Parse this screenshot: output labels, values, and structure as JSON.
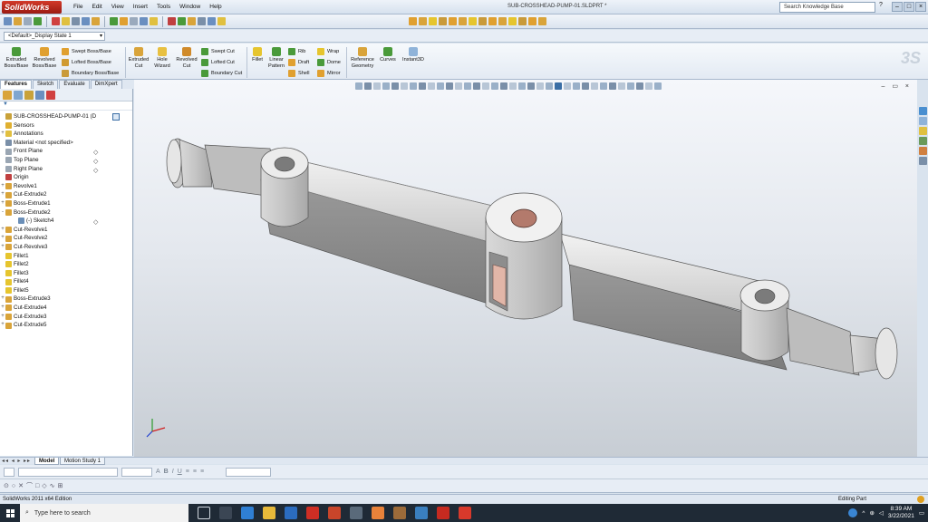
{
  "app": {
    "brand": "SolidWorks",
    "document_title": "SUB-CROSSHEAD-PUMP-01.SLDPRT *",
    "menu": [
      "File",
      "Edit",
      "View",
      "Insert",
      "Tools",
      "Window",
      "Help"
    ],
    "search_placeholder": "Search Knowledge Base",
    "help_label": "?"
  },
  "config": {
    "current": "<Default>_Display State 1"
  },
  "command_manager": {
    "large": [
      {
        "label": "Extruded Boss/Base",
        "icon": "extruded-boss-icon"
      },
      {
        "label": "Revolved Boss/Base",
        "icon": "revolved-boss-icon"
      },
      {
        "label": "Extruded Cut",
        "icon": "extruded-cut-icon"
      },
      {
        "label": "Hole Wizard",
        "icon": "hole-wizard-icon"
      },
      {
        "label": "Revolved Cut",
        "icon": "revolved-cut-icon"
      },
      {
        "label": "Fillet",
        "icon": "fillet-icon"
      },
      {
        "label": "Linear Pattern",
        "icon": "linear-pattern-icon"
      },
      {
        "label": "Reference Geometry",
        "icon": "reference-geometry-icon"
      },
      {
        "label": "Curves",
        "icon": "curves-icon"
      },
      {
        "label": "Instant3D",
        "icon": "instant3d-icon"
      }
    ],
    "stack1": [
      "Swept Boss/Base",
      "Lofted Boss/Base",
      "Boundary Boss/Base"
    ],
    "stack2": [
      "Swept Cut",
      "Lofted Cut",
      "Boundary Cut"
    ],
    "stack3": [
      "Rib",
      "Draft",
      "Shell"
    ],
    "stack4": [
      "Wrap",
      "Dome",
      "Mirror"
    ]
  },
  "tabs": [
    "Features",
    "Sketch",
    "Evaluate",
    "DimXpert"
  ],
  "tree": [
    {
      "label": "SUB-CROSSHEAD-PUMP-01 (D",
      "exp": "",
      "color": "#c9a23a",
      "root": true
    },
    {
      "label": "Sensors",
      "exp": "",
      "color": "#e0b030"
    },
    {
      "label": "Annotations",
      "exp": "+",
      "color": "#e2c040"
    },
    {
      "label": "Material <not specified>",
      "exp": "",
      "color": "#7a8fa8"
    },
    {
      "label": "Front Plane",
      "exp": "",
      "color": "#9aa6b3"
    },
    {
      "label": "Top Plane",
      "exp": "",
      "color": "#9aa6b3"
    },
    {
      "label": "Right Plane",
      "exp": "",
      "color": "#9aa6b3"
    },
    {
      "label": "Origin",
      "exp": "",
      "color": "#c04040"
    },
    {
      "label": "Revolve1",
      "exp": "+",
      "color": "#d9a43a"
    },
    {
      "label": "Cut-Extrude2",
      "exp": "+",
      "color": "#d9a43a"
    },
    {
      "label": "Boss-Extrude1",
      "exp": "+",
      "color": "#d9a43a"
    },
    {
      "label": "Boss-Extrude2",
      "exp": "-",
      "color": "#d9a43a"
    },
    {
      "label": "(-) Sketch4",
      "exp": "",
      "color": "#6b8fb8",
      "child": true
    },
    {
      "label": "Cut-Revolve1",
      "exp": "+",
      "color": "#d9a43a"
    },
    {
      "label": "Cut-Revolve2",
      "exp": "+",
      "color": "#d9a43a"
    },
    {
      "label": "Cut-Revolve3",
      "exp": "+",
      "color": "#d9a43a"
    },
    {
      "label": "Fillet1",
      "exp": "",
      "color": "#e6c52e"
    },
    {
      "label": "Fillet2",
      "exp": "",
      "color": "#e6c52e"
    },
    {
      "label": "Fillet3",
      "exp": "",
      "color": "#e6c52e"
    },
    {
      "label": "Fillet4",
      "exp": "",
      "color": "#e6c52e"
    },
    {
      "label": "Fillet5",
      "exp": "",
      "color": "#e6c52e"
    },
    {
      "label": "Boss-Extrude3",
      "exp": "+",
      "color": "#d9a43a"
    },
    {
      "label": "Cut-Extrude4",
      "exp": "+",
      "color": "#d9a43a"
    },
    {
      "label": "Cut-Extrude3",
      "exp": "+",
      "color": "#d9a43a"
    },
    {
      "label": "Cut-Extrude5",
      "exp": "+",
      "color": "#d9a43a"
    }
  ],
  "bottom_tabs": [
    "Model",
    "Motion Study 1"
  ],
  "status": {
    "left": "SolidWorks 2011 x64 Edition",
    "right": "Editing Part"
  },
  "taskbar": {
    "search_placeholder": "Type here to search",
    "time": "8:39 AM",
    "date": "3/22/2021"
  },
  "colors": {
    "accent": "#3a6ea5",
    "viewport_top": "#f5f7fb",
    "part": "#c8c8c8"
  }
}
